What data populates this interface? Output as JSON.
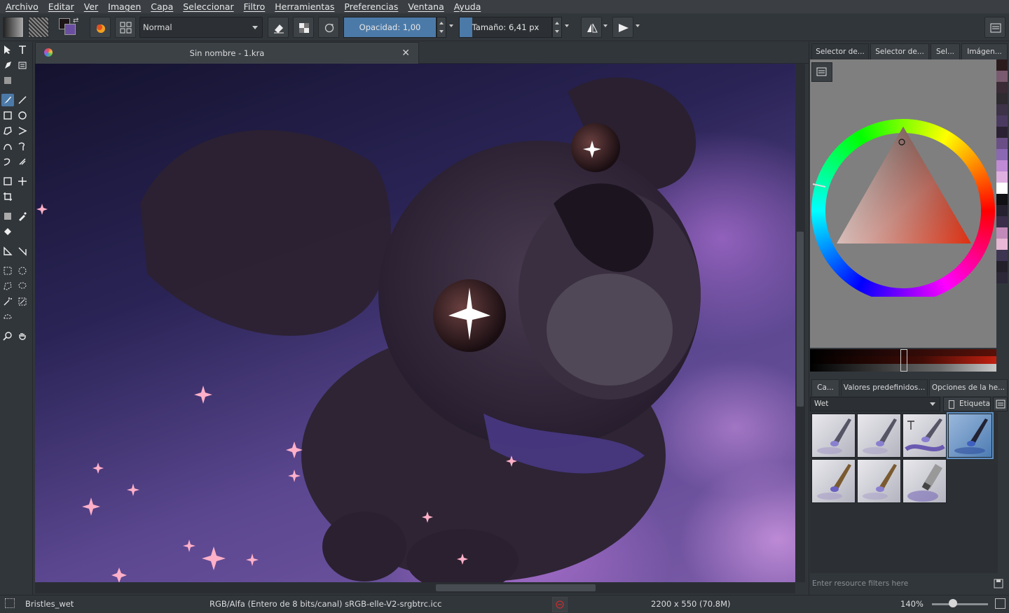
{
  "menu": [
    "Archivo",
    "Editar",
    "Ver",
    "Imagen",
    "Capa",
    "Seleccionar",
    "Filtro",
    "Herramientas",
    "Preferencias",
    "Ventana",
    "Ayuda"
  ],
  "toolbar": {
    "blend_mode": "Normal",
    "opacity_label": "Opacidad:  1,00",
    "opacity_value": 1.0,
    "size_label": "Tamaño:  6,41 px",
    "size_fraction": 0.14
  },
  "document": {
    "tab_title": "Sin nombre - 1.kra",
    "close_glyph": "✕"
  },
  "dock": {
    "top_tabs": [
      "Selector de...",
      "Selector de...",
      "Sel...",
      "Imágen..."
    ],
    "bottom_tabs": [
      "Ca...",
      "Valores predefinidos...",
      "Opciones de la he..."
    ],
    "preset_tag": "Wet",
    "tag_button": "Etiqueta",
    "filter_placeholder": "Enter resource filters here",
    "palette": [
      "#2b1a1c",
      "#7a5a6e",
      "#3a2b36",
      "#2e2a30",
      "#3d3248",
      "#4b3a60",
      "#2a2232",
      "#6a4f86",
      "#8b68b2",
      "#c08ad4",
      "#e0b0e0",
      "#ffffff",
      "#111014",
      "#252130",
      "#3a2e4a",
      "#c28ab8",
      "#e8b8d4",
      "#3c3450",
      "#23202a",
      "#2c2838"
    ]
  },
  "status": {
    "preset_name": "Bristles_wet",
    "color_profile": "RGB/Alfa (Entero de 8 bits/canal)  sRGB-elle-V2-srgbtrc.icc",
    "dimensions": "2200 x 550 (70.8M)",
    "zoom": "140%",
    "zoom_fraction": 0.3
  },
  "colors": {
    "accent": "#4c7aa8",
    "panel_bg": "#31363b",
    "menubar_bg": "#3b3f44"
  }
}
